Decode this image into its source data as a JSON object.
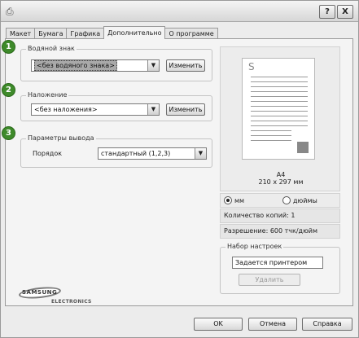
{
  "window": {
    "title_buttons": {
      "help": "?",
      "close": "X"
    }
  },
  "tabs": [
    {
      "label": "Макет"
    },
    {
      "label": "Бумага"
    },
    {
      "label": "Графика"
    },
    {
      "label": "Дополнительно"
    },
    {
      "label": "О программе"
    }
  ],
  "badges": [
    "1",
    "2",
    "3"
  ],
  "watermark": {
    "group_label": "Водяной знак",
    "selected": "<без водяного знака>",
    "edit_button": "Изменить"
  },
  "overlay": {
    "group_label": "Наложение",
    "selected": "<без наложения>",
    "edit_button": "Изменить"
  },
  "output": {
    "group_label": "Параметры вывода",
    "order_label": "Порядок",
    "order_selected": "стандартный (1,2,3)"
  },
  "preview": {
    "paper_name": "A4",
    "paper_dims": "210 x 297 мм",
    "units": {
      "mm": "мм",
      "inches": "дюймы",
      "selected": "мм"
    },
    "copies": "Количество копий: 1",
    "resolution": "Разрешение: 600 тчк/дюйм"
  },
  "presets": {
    "group_label": "Набор настроек",
    "selected": "Задается принтером",
    "delete_button": "Удалить"
  },
  "logo": {
    "brand": "SAMSUNG",
    "sub": "ELECTRONICS"
  },
  "footer": {
    "ok": "OK",
    "cancel": "Отмена",
    "help": "Справка"
  }
}
